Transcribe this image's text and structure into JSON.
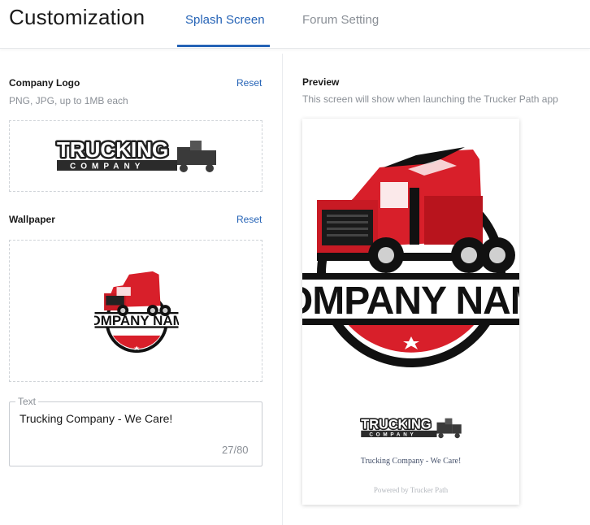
{
  "header": {
    "title": "Customization",
    "tabs": [
      {
        "label": "Splash Screen",
        "active": true
      },
      {
        "label": "Forum Setting",
        "active": false
      }
    ]
  },
  "company_logo": {
    "label": "Company Logo",
    "hint": "PNG, JPG, up to 1MB each",
    "reset": "Reset",
    "logo_text": "TRUCKING",
    "logo_subtext": "COMPANY"
  },
  "wallpaper": {
    "label": "Wallpaper",
    "reset": "Reset",
    "emblem_text": "COMPANY NAME"
  },
  "text_field": {
    "legend": "Text",
    "value": "Trucking Company - We Care!",
    "count": "27/80"
  },
  "preview": {
    "label": "Preview",
    "description": "This screen will show when launching the Trucker Path app",
    "emblem_text": "COMPANY NAME",
    "logo_text": "TRUCKING",
    "logo_subtext": "COMPANY",
    "caption": "Trucking Company - We Care!",
    "powered": "Powered by Trucker Path"
  },
  "colors": {
    "accent": "#2563b6",
    "truck_red": "#d81f2a",
    "muted": "#8a8f96"
  }
}
